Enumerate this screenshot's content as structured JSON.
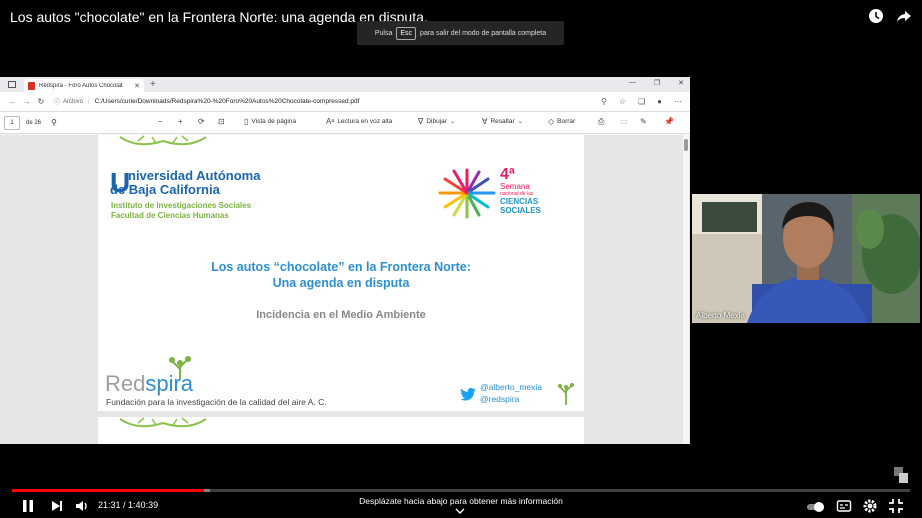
{
  "video": {
    "title": "Los autos \"chocolate\" en la Frontera Norte: una agenda en disputa.",
    "fullscreen_hint_prefix": "Pulsa",
    "fullscreen_hint_key": "Esc",
    "fullscreen_hint_suffix": "para salir del modo de pantalla completa",
    "time_current": "21:31",
    "time_separator": " / ",
    "time_total": "1:40:39",
    "progress_fraction": 0.2138,
    "buffered_fraction": 0.22,
    "scroll_hint": "Desplázate hacia abajo para obtener más información",
    "accent_color": "#ff0000"
  },
  "browser": {
    "tab_title": "Redspira - Foro Autos Chocolat",
    "address_protocol": "Archivo",
    "address_url": "C:/Users/curie/Downloads/Redspira%20-%20Foro%20Autos%20Chocolate-compressed.pdf"
  },
  "pdf_toolbar": {
    "page_current": "1",
    "page_total": "de 26",
    "page_view": "Vista de página",
    "read_aloud": "Lectura en voz alta",
    "draw": "Dibujar",
    "highlight": "Resaltar",
    "erase": "Borrar"
  },
  "slide": {
    "uabc_initial": "U",
    "uabc_line1": "niversidad Autónoma",
    "uabc_line2": "de Baja California",
    "uabc_sub1": "Instituto de Investigaciones Sociales",
    "uabc_sub2": "Facultad de Ciencias Humanas",
    "semana_num": "4ª",
    "semana_word": "Semana",
    "semana_nacional": "nacional de las",
    "semana_ciencias": "CIENCIAS",
    "semana_sociales": "SOCIALES",
    "title_line1": "Los autos “chocolate” en la Frontera Norte:",
    "title_line2": "Una agenda en disputa",
    "subtitle": "Incidencia en el Medio Ambiente",
    "redspira_red": "Red",
    "redspira_spira": "spira",
    "redspira_tagline": "Fundación para la investigación de la calidad del aire A. C.",
    "twitter1": "@alberto_mexia",
    "twitter2": "@redspira"
  },
  "webcam": {
    "participant_name": "Alberto Mexia"
  }
}
